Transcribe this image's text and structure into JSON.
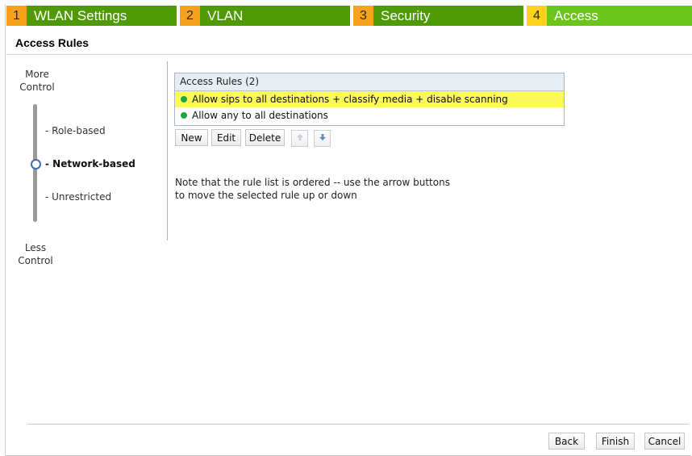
{
  "wizard": {
    "steps": [
      {
        "num": "1",
        "label": "WLAN Settings"
      },
      {
        "num": "2",
        "label": "VLAN"
      },
      {
        "num": "3",
        "label": "Security"
      },
      {
        "num": "4",
        "label": "Access"
      }
    ],
    "active_step": 4
  },
  "page_title": "Access Rules",
  "slider": {
    "top_label": "More\nControl",
    "bottom_label": "Less\nControl",
    "options": [
      "- Role-based",
      "- Network-based",
      "- Unrestricted"
    ],
    "selected": "- Network-based"
  },
  "rules_table": {
    "header": "Access Rules (2)",
    "rows": [
      {
        "text": "Allow sips to all destinations + classify media + disable scanning",
        "selected": true
      },
      {
        "text": "Allow any to all destinations",
        "selected": false
      }
    ]
  },
  "toolbar": {
    "new_label": "New",
    "edit_label": "Edit",
    "delete_label": "Delete",
    "up_icon": "arrow-up-icon",
    "down_icon": "arrow-down-icon"
  },
  "note": "Note that the rule list is ordered -- use the arrow buttons\nto move the selected rule up or down",
  "footer": {
    "back_label": "Back",
    "finish_label": "Finish",
    "cancel_label": "Cancel"
  },
  "colors": {
    "step_bg": "#4f9a06",
    "step_active_bg": "#6cc51b",
    "step_num_bg": "#f7a21b",
    "step_active_num_bg": "#ffd21f",
    "selected_row": "#fbf95c",
    "status_dot": "#1fa83a"
  }
}
